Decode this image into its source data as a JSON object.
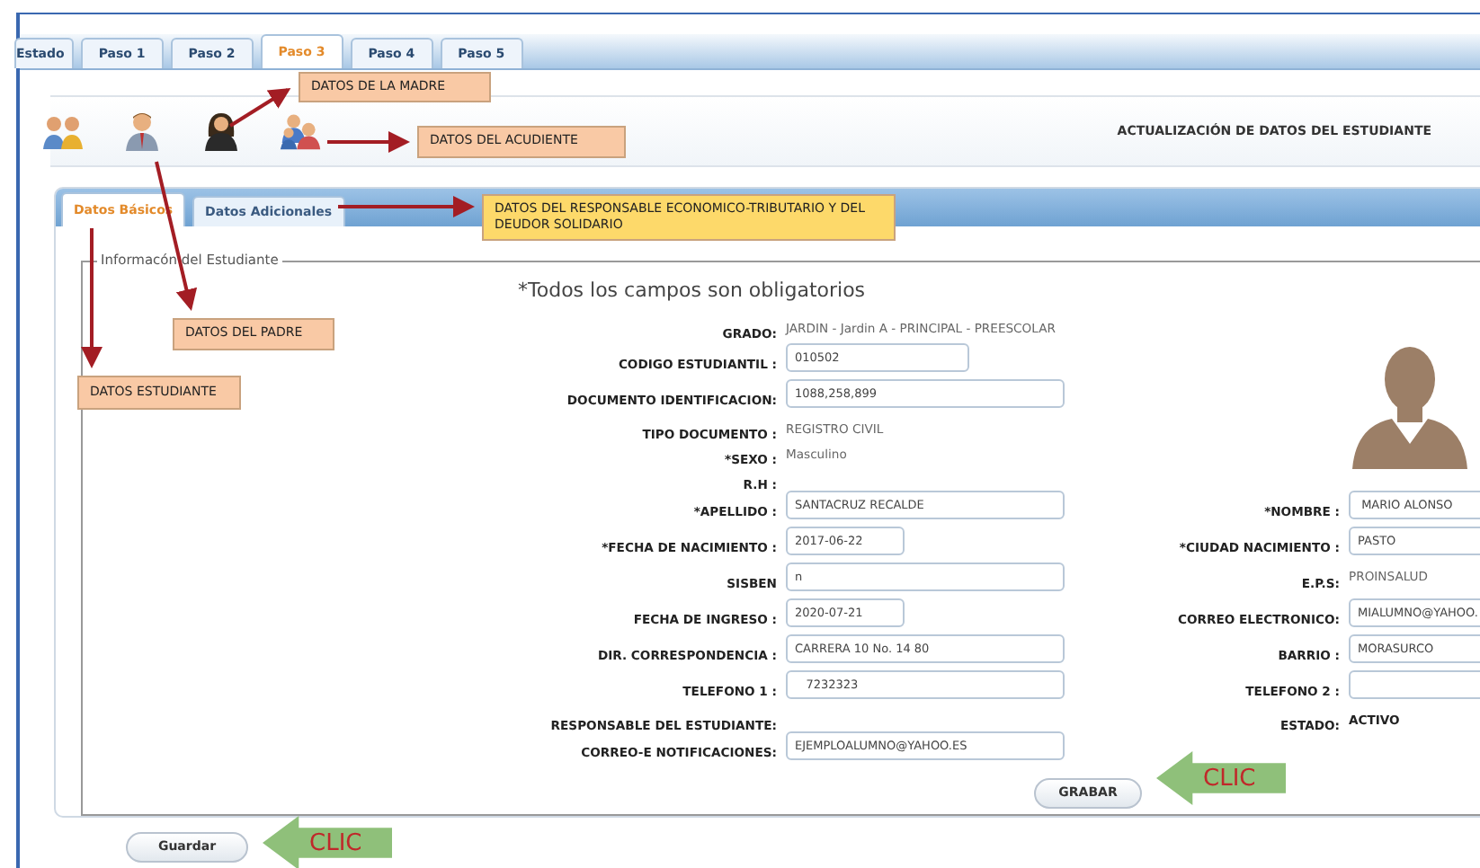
{
  "steps": [
    {
      "label": "Estado",
      "selected": false
    },
    {
      "label": "Paso 1",
      "selected": false
    },
    {
      "label": "Paso 2",
      "selected": false
    },
    {
      "label": "Paso 3",
      "selected": true
    },
    {
      "label": "Paso 4",
      "selected": false
    },
    {
      "label": "Paso 5",
      "selected": false
    }
  ],
  "page_title": "ACTUALIZACIÓN DE DATOS DEL ESTUDIANTE",
  "sections": [
    {
      "label": "Datos Básicos",
      "selected": true
    },
    {
      "label": "Datos Adicionales",
      "selected": false
    }
  ],
  "fieldset": {
    "legend": "Informacón del Estudiante",
    "note": "*Todos los campos son obligatorios",
    "top_rows": [
      {
        "label": "GRADO:",
        "kind": "text",
        "value": "JARDIN - Jardin A - PRINCIPAL - PREESCOLAR"
      },
      {
        "label": "CODIGO ESTUDIANTIL :",
        "kind": "field",
        "value": "010502"
      },
      {
        "label": "DOCUMENTO IDENTIFICACION:",
        "kind": "field",
        "value": "1088,258,899"
      },
      {
        "label": "TIPO DOCUMENTO :",
        "kind": "text",
        "value": "REGISTRO CIVIL"
      },
      {
        "label": "*SEXO :",
        "kind": "text",
        "value": "Masculino"
      },
      {
        "label": "R.H :",
        "kind": "text"
      }
    ],
    "rows": [
      {
        "left": {
          "label": "*APELLIDO :",
          "kind": "field",
          "value": "SANTACRUZ RECALDE"
        },
        "right": {
          "label": "*NOMBRE :",
          "kind": "field",
          "value": " MARIO ALONSO"
        }
      },
      {
        "left": {
          "label": "*FECHA DE NACIMIENTO :",
          "kind": "field",
          "value": "2017-06-22"
        },
        "right": {
          "label": "*CIUDAD NACIMIENTO :",
          "kind": "field",
          "value": "PASTO"
        }
      },
      {
        "left": {
          "label": "SISBEN",
          "kind": "field",
          "value": "n"
        },
        "right": {
          "label": "E.P.S:",
          "kind": "text",
          "value": "PROINSALUD"
        }
      },
      {
        "left": {
          "label": "FECHA DE INGRESO :",
          "kind": "field",
          "value": "2020-07-21"
        },
        "right": {
          "label": "CORREO ELECTRONICO:",
          "kind": "field",
          "value": "MIALUMNO@YAHOO."
        }
      },
      {
        "left": {
          "label": "DIR. CORRESPONDENCIA :",
          "kind": "field",
          "value": "CARRERA 10 No. 14 80"
        },
        "right": {
          "label": "BARRIO :",
          "kind": "field",
          "value": "MORASURCO"
        }
      },
      {
        "left": {
          "label": "TELEFONO 1 :",
          "kind": "field",
          "value": "   7232323"
        },
        "right": {
          "label": "TELEFONO 2 :",
          "kind": "field"
        }
      },
      {
        "left": {
          "label": "RESPONSABLE DEL ESTUDIANTE:",
          "kind": "text"
        },
        "right": {
          "label": "ESTADO:",
          "kind": "strong",
          "value": "ACTIVO"
        }
      },
      {
        "left": {
          "label": "CORREO-E NOTIFICACIONES:",
          "kind": "field",
          "value": "EJEMPLOALUMNO@YAHOO.ES"
        }
      }
    ],
    "save_button": "GRABAR"
  },
  "guardar_button": "Guardar",
  "callouts": [
    {
      "text": "DATOS DE LA MADRE",
      "color": "#f9c9a5"
    },
    {
      "text": "DATOS DEL  ACUDIENTE",
      "color": "#f9c9a5"
    },
    {
      "text": "DATOS DEL  RESPONSABLE ECONOMICO-TRIBUTARIO Y DEL DEUDOR SOLIDARIO",
      "color": "#fdd96a"
    },
    {
      "text": "DATOS DEL PADRE",
      "color": "#f9c9a5"
    },
    {
      "text": "DATOS ESTUDIANTE",
      "color": "#f9c9a5"
    }
  ],
  "clic_marks": [
    "CLIC",
    "CLIC"
  ]
}
